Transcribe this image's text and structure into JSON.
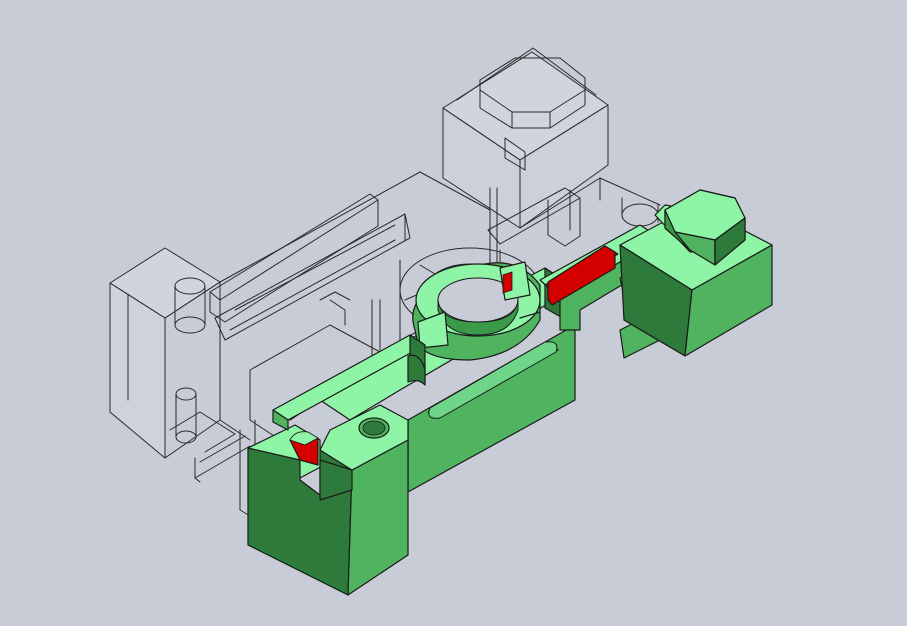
{
  "viewport": {
    "background": "#c8ccd6"
  },
  "model": {
    "wireframe_color": "#2a2a2a",
    "ghost_fill": "#dfe2e8",
    "green_top": "#8ef5a6",
    "green_front": "#4fb35f",
    "green_side": "#2e7a3a",
    "red_face": "#d40000"
  }
}
